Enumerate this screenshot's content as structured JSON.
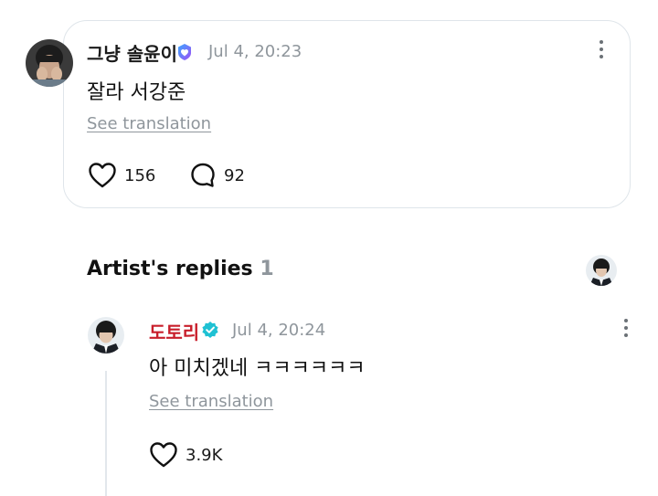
{
  "comment": {
    "username": "그냥 솔윤이",
    "timestamp": "Jul 4, 20:23",
    "text": "잘라 서강준",
    "see_translation": "See translation",
    "likes": "156",
    "replies": "92",
    "badge_color": "#7b5cf5"
  },
  "artist_replies": {
    "title": "Artist's replies",
    "count": "1"
  },
  "reply": {
    "username": "도토리",
    "username_color": "#c81e2b",
    "timestamp": "Jul 4, 20:24",
    "text": "아 미치겠네 ㅋㅋㅋㅋㅋㅋ",
    "see_translation": "See translation",
    "likes": "3.9K",
    "badge_color": "#1fc1d3"
  },
  "icons": [
    "heart-icon",
    "comment-bubble-icon",
    "more-vertical-icon",
    "verified-badge-icon"
  ]
}
